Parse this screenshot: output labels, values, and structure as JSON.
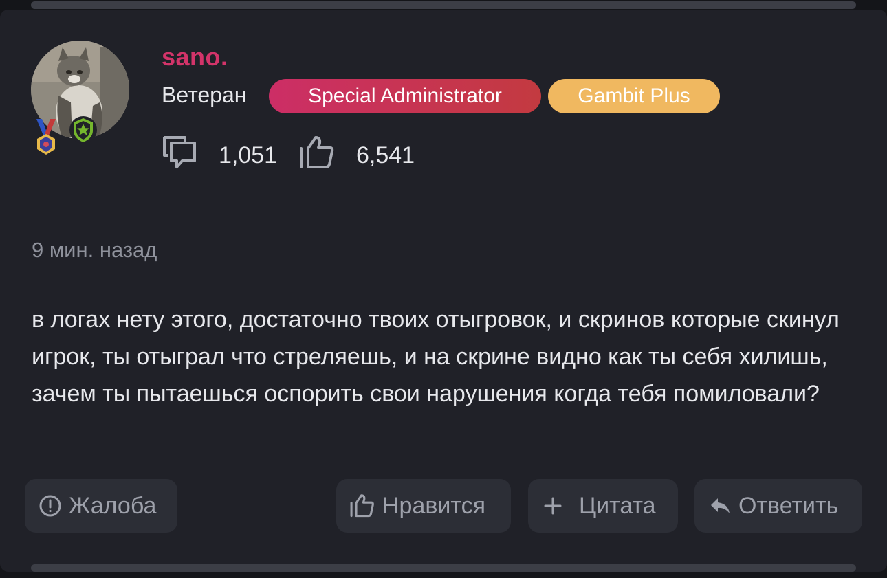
{
  "post": {
    "username": "sano.",
    "rank": "Ветеран",
    "badges": [
      {
        "label": "Special Administrator",
        "color": "#d1306a"
      },
      {
        "label": "Gambit Plus",
        "color": "#f0b860"
      }
    ],
    "stats": {
      "messages": "1,051",
      "likes": "6,541"
    },
    "time_ago": "9 мин. назад",
    "message": "в логах нету этого, достаточно твоих отыгровок, и скринов которые скинул игрок, ты отыграл что стреляешь, и на скрине видно как ты себя хилишь, зачем ты пытаешься оспорить свои нарушения когда тебя помиловали?"
  },
  "actions": {
    "report": "Жалоба",
    "like": "Нравится",
    "quote": "Цитата",
    "reply": "Ответить"
  },
  "icons": [
    "medal-icon",
    "shield-star-icon",
    "messages-icon",
    "thumbs-up-icon",
    "alert-circle-icon",
    "plus-icon",
    "reply-arrow-icon"
  ],
  "colors": {
    "username": "#d3346a",
    "background": "#202128",
    "text": "#e7e8ec",
    "muted": "#8f929c"
  }
}
